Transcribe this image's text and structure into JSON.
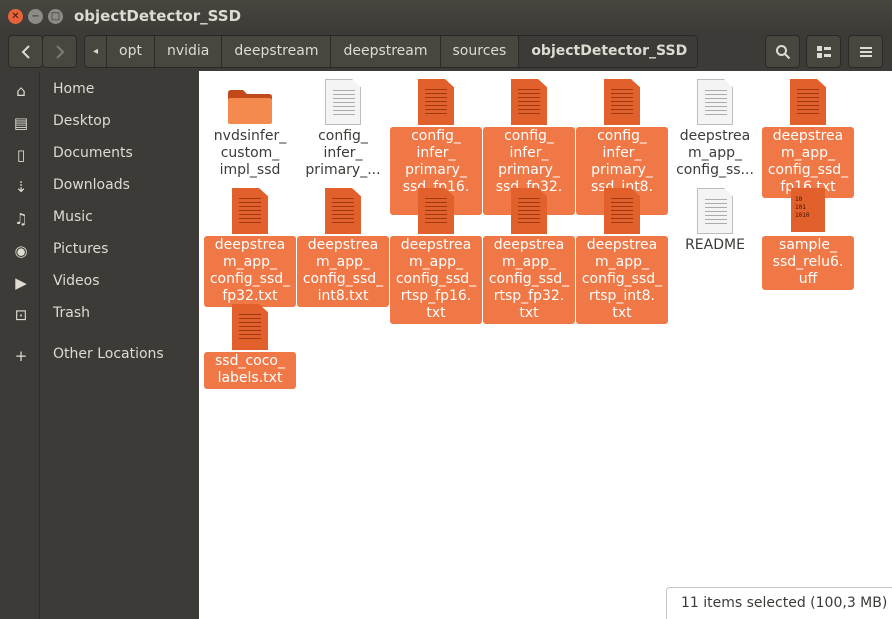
{
  "window": {
    "title": "objectDetector_SSD",
    "controls": [
      "close",
      "minimize",
      "maximize"
    ]
  },
  "toolbar": {
    "back_icon": "chevron-left",
    "forward_icon": "chevron-right",
    "path_left_arrow": "◂",
    "path_right_arrow": "▸",
    "breadcrumbs": [
      "opt",
      "nvidia",
      "deepstream",
      "deepstream",
      "sources",
      "objectDetector_SSD"
    ],
    "search_icon": "search-icon",
    "view_icon": "view-toggle-icon",
    "menu_icon": "hamburger-menu-icon"
  },
  "sidebar": {
    "items": [
      {
        "label": "Home",
        "icon": "home-icon"
      },
      {
        "label": "Desktop",
        "icon": "folder-icon"
      },
      {
        "label": "Documents",
        "icon": "document-icon"
      },
      {
        "label": "Downloads",
        "icon": "download-icon"
      },
      {
        "label": "Music",
        "icon": "music-icon"
      },
      {
        "label": "Pictures",
        "icon": "camera-icon"
      },
      {
        "label": "Videos",
        "icon": "video-icon"
      },
      {
        "label": "Trash",
        "icon": "trash-icon"
      },
      {
        "label": "Other Locations",
        "icon": "plus-icon"
      }
    ]
  },
  "files": [
    {
      "name": "nvdsinfer_\ncustom_\nimpl_ssd",
      "type": "folder",
      "selected": false
    },
    {
      "name": "config_\ninfer_\nprimary_...",
      "type": "text",
      "selected": false
    },
    {
      "name": "config_\ninfer_\nprimary_\nssd_fp16.\ntxt",
      "type": "text",
      "selected": true
    },
    {
      "name": "config_\ninfer_\nprimary_\nssd_fp32.\ntxt",
      "type": "text",
      "selected": true
    },
    {
      "name": "config_\ninfer_\nprimary_\nssd_int8.\ntxt",
      "type": "text",
      "selected": true
    },
    {
      "name": "deepstrea\nm_app_\nconfig_ss...",
      "type": "text",
      "selected": false
    },
    {
      "name": "deepstrea\nm_app_\nconfig_ssd_\nfp16.txt",
      "type": "text",
      "selected": true
    },
    {
      "name": "deepstrea\nm_app_\nconfig_ssd_\nfp32.txt",
      "type": "text",
      "selected": true
    },
    {
      "name": "deepstrea\nm_app_\nconfig_ssd_\nint8.txt",
      "type": "text",
      "selected": true
    },
    {
      "name": "deepstrea\nm_app_\nconfig_ssd_\nrtsp_fp16.\ntxt",
      "type": "text",
      "selected": true
    },
    {
      "name": "deepstrea\nm_app_\nconfig_ssd_\nrtsp_fp32.\ntxt",
      "type": "text",
      "selected": true
    },
    {
      "name": "deepstrea\nm_app_\nconfig_ssd_\nrtsp_int8.\ntxt",
      "type": "text",
      "selected": true
    },
    {
      "name": "README",
      "type": "text",
      "selected": false
    },
    {
      "name": "sample_\nssd_relu6.\nuff",
      "type": "binary",
      "selected": true
    },
    {
      "name": "ssd_coco_\nlabels.txt",
      "type": "text",
      "selected": true
    }
  ],
  "binary_icon_text": "10\n101\n1010",
  "status": {
    "text": "11 items selected  (100,3 MB)"
  },
  "colors": {
    "selection": "#f07746",
    "accent": "#e2602c",
    "sidebar_bg": "#3c3b37"
  }
}
